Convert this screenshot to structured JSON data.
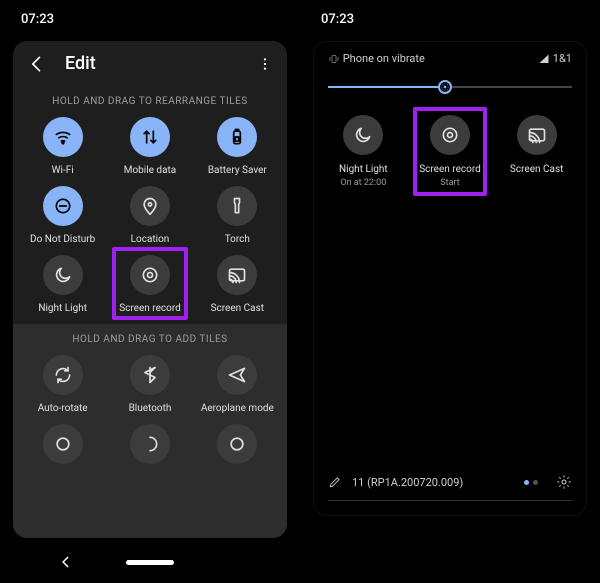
{
  "colors": {
    "accent": "#8ab4f8",
    "highlight": "#a020f0"
  },
  "left": {
    "time": "07:23",
    "title": "Edit",
    "rearrange_label": "HOLD AND DRAG TO REARRANGE TILES",
    "add_label": "HOLD AND DRAG TO ADD TILES",
    "active_tiles": [
      {
        "id": "wifi",
        "label": "Wi-Fi",
        "icon": "wifi",
        "style": "blue"
      },
      {
        "id": "mobile-data",
        "label": "Mobile data",
        "icon": "swap",
        "style": "blue"
      },
      {
        "id": "battery-saver",
        "label": "Battery Saver",
        "icon": "battery",
        "style": "blue"
      },
      {
        "id": "dnd",
        "label": "Do Not Disturb",
        "icon": "dnd",
        "style": "blue"
      },
      {
        "id": "location",
        "label": "Location",
        "icon": "pin",
        "style": "grey"
      },
      {
        "id": "torch",
        "label": "Torch",
        "icon": "torch",
        "style": "grey"
      },
      {
        "id": "night-light",
        "label": "Night Light",
        "icon": "moon",
        "style": "grey"
      },
      {
        "id": "screen-record",
        "label": "Screen record",
        "icon": "record",
        "style": "grey",
        "highlight": true
      },
      {
        "id": "screen-cast",
        "label": "Screen Cast",
        "icon": "cast",
        "style": "grey"
      }
    ],
    "add_tiles": [
      {
        "id": "auto-rotate",
        "label": "Auto-rotate",
        "icon": "rotate",
        "style": "grey"
      },
      {
        "id": "bluetooth",
        "label": "Bluetooth",
        "icon": "bluetooth",
        "style": "grey"
      },
      {
        "id": "aeroplane",
        "label": "Aeroplane mode",
        "icon": "plane",
        "style": "grey"
      }
    ]
  },
  "right": {
    "time": "07:23",
    "vibrate_label": "Phone on vibrate",
    "carrier": "1&1",
    "brightness_percent": 48,
    "tiles": [
      {
        "id": "night-light",
        "label": "Night Light",
        "sublabel": "On at 22:00",
        "icon": "moon"
      },
      {
        "id": "screen-record",
        "label": "Screen record",
        "sublabel": "Start",
        "icon": "record",
        "highlight": true
      },
      {
        "id": "screen-cast",
        "label": "Screen Cast",
        "sublabel": "",
        "icon": "cast"
      }
    ],
    "build": "11 (RP1A.200720.009)",
    "page_count": 2,
    "page_index": 0
  }
}
